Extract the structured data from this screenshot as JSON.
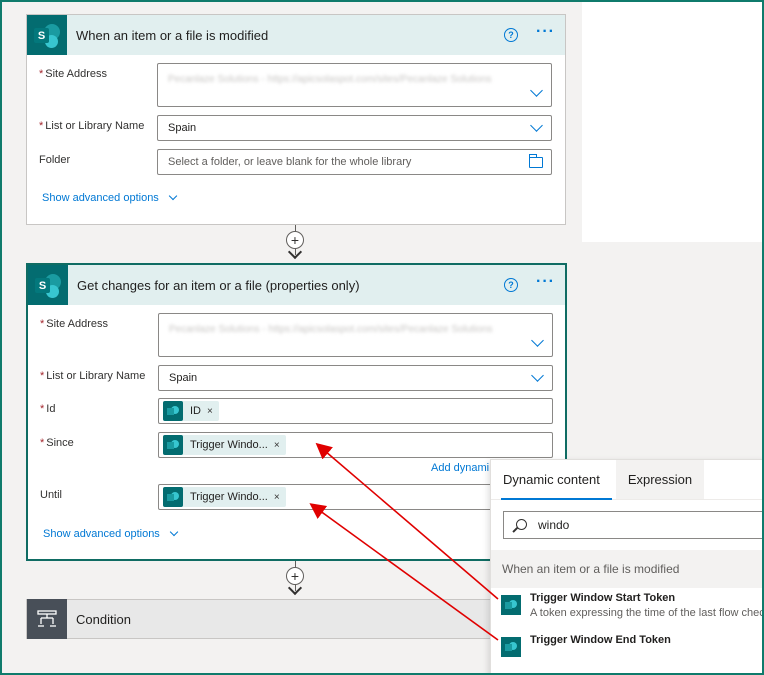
{
  "trigger_card": {
    "title": "When an item or a file is modified",
    "site_address_label": "Site Address",
    "site_address_value": "Pecanlaze Solutions - https://apicsolaspot.com/sites/Pecanlaze Solutions",
    "list_label": "List or Library Name",
    "list_value": "Spain",
    "folder_label": "Folder",
    "folder_placeholder": "Select a folder, or leave blank for the whole library",
    "advanced_label": "Show advanced options"
  },
  "action_card": {
    "title": "Get changes for an item or a file (properties only)",
    "site_address_label": "Site Address",
    "site_address_value": "Pecanlaze Solutions - https://apicsolaspot.com/sites/Pecanlaze Solutions",
    "list_label": "List or Library Name",
    "list_value": "Spain",
    "id_label": "Id",
    "id_token": "ID",
    "since_label": "Since",
    "since_token": "Trigger Windo...",
    "until_label": "Until",
    "until_token": "Trigger Windo...",
    "add_dynamic_label": "Add dynami",
    "advanced_label": "Show advanced options"
  },
  "condition_card": {
    "title": "Condition"
  },
  "dynamic_panel": {
    "tab_dynamic": "Dynamic content",
    "tab_expression": "Expression",
    "search_value": "windo",
    "section_title": "When an item or a file is modified",
    "items": [
      {
        "name": "Trigger Window Start Token",
        "desc": "A token expressing the time of the last flow check"
      },
      {
        "name": "Trigger Window End Token",
        "desc": ""
      }
    ]
  },
  "symbols": {
    "plus": "+",
    "close": "×",
    "help": "?",
    "more": "···",
    "required": "*",
    "sp_letter": "S"
  },
  "colors": {
    "accent": "#0078d4",
    "sharepoint": "#036c70",
    "header_bg": "#e1efef",
    "annotation_arrow": "#e00000"
  }
}
